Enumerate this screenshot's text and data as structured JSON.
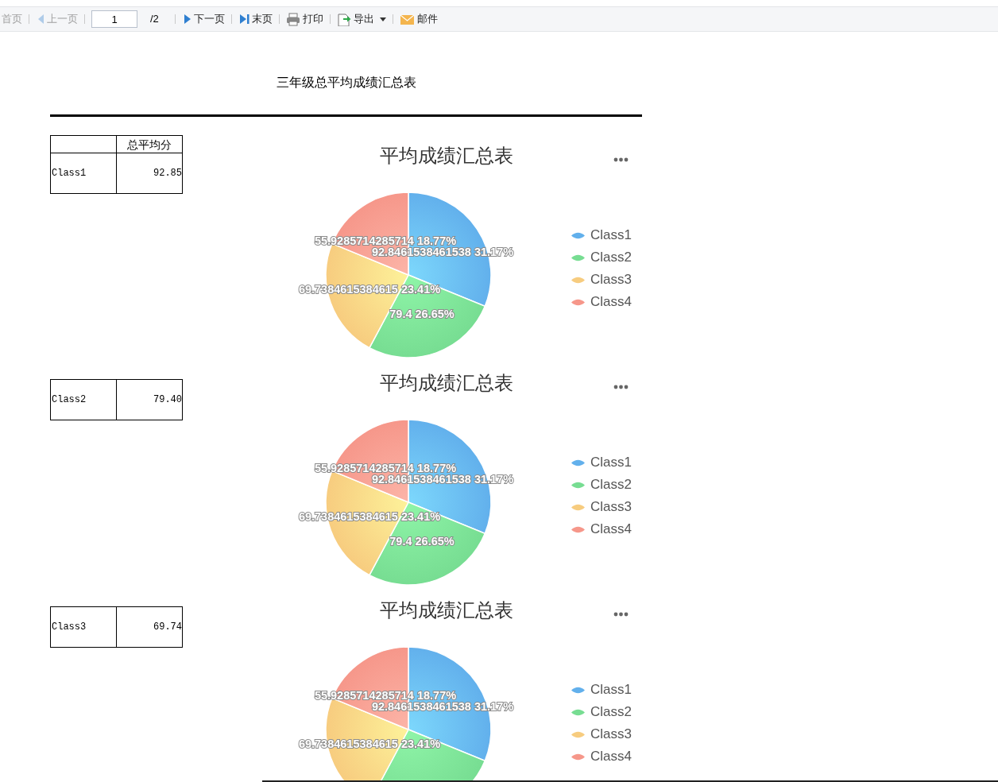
{
  "toolbar": {
    "items": [
      {
        "kind": "first",
        "label": "首页",
        "disabled": true
      },
      {
        "kind": "prev",
        "label": "上一页",
        "disabled": true
      },
      {
        "kind": "page",
        "value": "1",
        "total": "/2"
      },
      {
        "kind": "next",
        "label": "下一页",
        "disabled": false
      },
      {
        "kind": "last",
        "label": "末页",
        "disabled": false
      },
      {
        "kind": "print",
        "label": "打印",
        "disabled": false
      },
      {
        "kind": "export",
        "label": "导出",
        "disabled": false
      },
      {
        "kind": "mail",
        "label": "邮件",
        "disabled": false
      }
    ]
  },
  "report": {
    "title": "三年级总平均成绩汇总表",
    "sections": [
      {
        "table": {
          "column_header": "总平均分",
          "rows": [
            {
              "label": "Class1",
              "value": "92.85"
            }
          ]
        },
        "chart": {
          "legend": [
            {
              "color": "#62b0ec"
            },
            {
              "color": "#77dd92"
            },
            {
              "color": "#f7cc7f"
            },
            {
              "color": "#f6978a"
            }
          ],
          "chart_data": {
            "type": "pie",
            "title": "平均成绩汇总表",
            "categories": [
              "Class1",
              "Class2",
              "Class3",
              "Class4"
            ],
            "values": [
              92.8461538461538,
              79.4,
              69.7384615384615,
              55.9285714285714
            ],
            "value_labels": [
              "92.8461538461538  31.17%",
              "79.4  26.65%",
              "69.7384615384615  23.41%",
              "55.9285714285714  18.77%"
            ]
          }
        }
      },
      {
        "table": {
          "rows": [
            {
              "label": "Class2",
              "value": "79.40"
            }
          ]
        },
        "chart": {
          "legend": [
            {
              "color": "#62b0ec"
            },
            {
              "color": "#77dd92"
            },
            {
              "color": "#f7cc7f"
            },
            {
              "color": "#f6978a"
            }
          ],
          "chart_data": {
            "type": "pie",
            "title": "平均成绩汇总表",
            "categories": [
              "Class1",
              "Class2",
              "Class3",
              "Class4"
            ],
            "values": [
              92.8461538461538,
              79.4,
              69.7384615384615,
              55.9285714285714
            ],
            "value_labels": [
              "92.8461538461538  31.17%",
              "79.4  26.65%",
              "69.7384615384615  23.41%",
              "55.9285714285714  18.77%"
            ]
          }
        }
      },
      {
        "table": {
          "rows": [
            {
              "label": "Class3",
              "value": "69.74"
            }
          ]
        },
        "chart": {
          "legend": [
            {
              "color": "#62b0ec"
            },
            {
              "color": "#77dd92"
            },
            {
              "color": "#f7cc7f"
            },
            {
              "color": "#f6978a"
            }
          ],
          "chart_data": {
            "type": "pie",
            "title": "平均成绩汇总表",
            "categories": [
              "Class1",
              "Class2",
              "Class3",
              "Class4"
            ],
            "values": [
              92.8461538461538,
              79.4,
              69.7384615384615,
              55.9285714285714
            ],
            "value_labels": [
              "92.8461538461538  31.17%",
              null,
              "69.7384615384615  23.41%",
              "55.9285714285714  18.77%"
            ]
          }
        }
      }
    ]
  }
}
